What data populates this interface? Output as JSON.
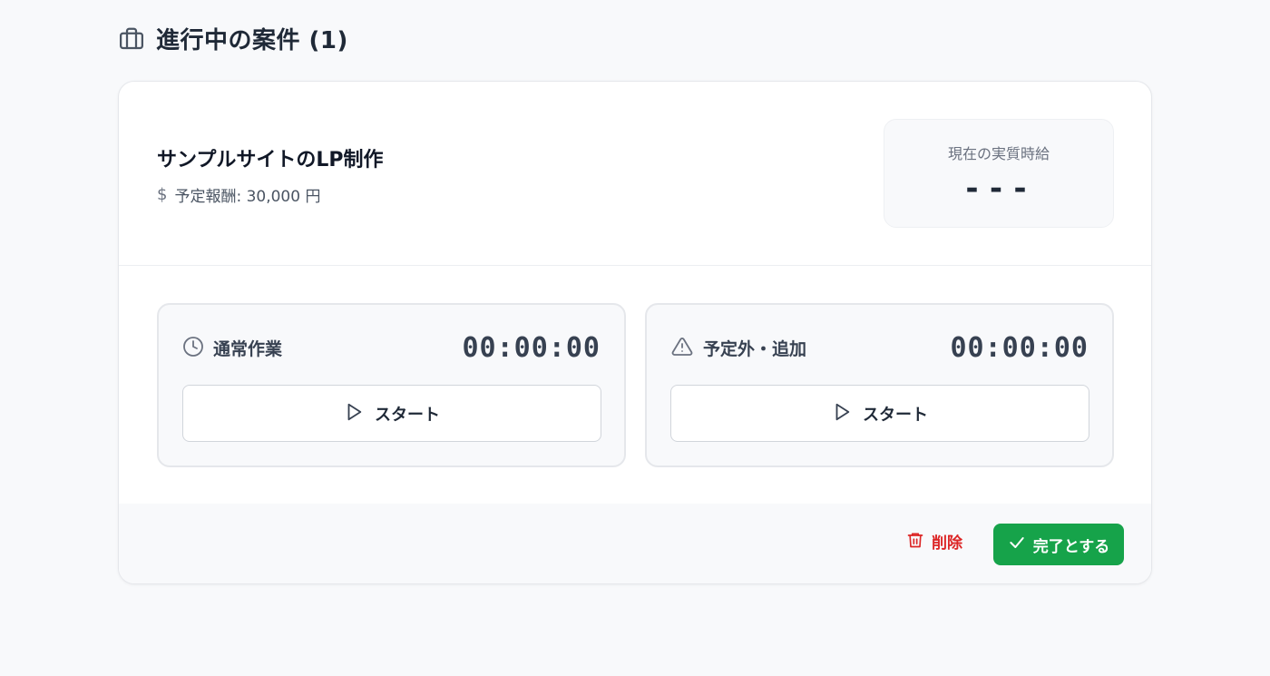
{
  "header": {
    "title": "進行中の案件 (1)",
    "icon": "briefcase-icon"
  },
  "project": {
    "name": "サンプルサイトのLP制作",
    "reward_symbol": "$",
    "reward_text": "予定報酬: 30,000 円"
  },
  "rate": {
    "label": "現在の実質時給",
    "value": "---"
  },
  "timers": [
    {
      "label": "通常作業",
      "value": "00:00:00",
      "icon": "clock-icon",
      "start_label": "スタート"
    },
    {
      "label": "予定外・追加",
      "value": "00:00:00",
      "icon": "warning-icon",
      "start_label": "スタート"
    }
  ],
  "footer": {
    "delete_label": "削除",
    "complete_label": "完了とする"
  },
  "colors": {
    "accent_green": "#16a34a",
    "danger_red": "#dc2626"
  }
}
